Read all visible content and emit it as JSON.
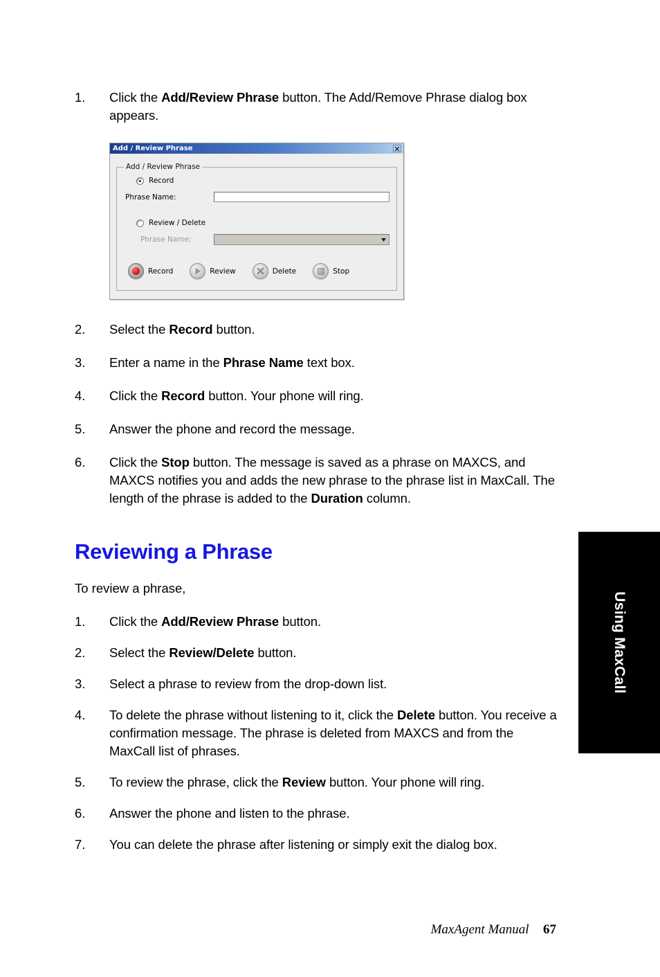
{
  "page": {
    "heading": "Reviewing a Phrase",
    "lead_text": "To review a phrase,",
    "heading_color": "#1616e0"
  },
  "steps_add": [
    {
      "num": "1.",
      "parts": [
        {
          "text": "Click the ",
          "bold": false
        },
        {
          "text": "Add/Review Phrase",
          "bold": true
        },
        {
          "text": " button. The Add/Remove Phrase dialog box appears.",
          "bold": false
        }
      ]
    }
  ],
  "steps_record": [
    {
      "num": "2.",
      "parts": [
        {
          "text": "Select the ",
          "bold": false
        },
        {
          "text": "Record",
          "bold": true
        },
        {
          "text": " button.",
          "bold": false
        }
      ]
    },
    {
      "num": "3.",
      "parts": [
        {
          "text": "Enter a name in the ",
          "bold": false
        },
        {
          "text": "Phrase Name",
          "bold": true
        },
        {
          "text": " text box.",
          "bold": false
        }
      ]
    },
    {
      "num": "4.",
      "parts": [
        {
          "text": "Click the ",
          "bold": false
        },
        {
          "text": "Record",
          "bold": true
        },
        {
          "text": " button. Your phone will ring.",
          "bold": false
        }
      ]
    },
    {
      "num": "5.",
      "parts": [
        {
          "text": "Answer the phone and record the message.",
          "bold": false
        }
      ]
    },
    {
      "num": "6.",
      "parts": [
        {
          "text": "Click the ",
          "bold": false
        },
        {
          "text": "Stop",
          "bold": true
        },
        {
          "text": " button. The message is saved as a phrase on MAXCS, and MAXCS notifies you and adds the new phrase to the phrase list in MaxCall. The length of the phrase is added to the ",
          "bold": false
        },
        {
          "text": "Duration",
          "bold": true
        },
        {
          "text": " column.",
          "bold": false
        }
      ]
    }
  ],
  "steps_review": [
    {
      "num": "1.",
      "parts": [
        {
          "text": "Click the ",
          "bold": false
        },
        {
          "text": "Add/Review Phrase",
          "bold": true
        },
        {
          "text": " button.",
          "bold": false
        }
      ]
    },
    {
      "num": "2.",
      "parts": [
        {
          "text": "Select the ",
          "bold": false
        },
        {
          "text": "Review/Delete",
          "bold": true
        },
        {
          "text": " button.",
          "bold": false
        }
      ]
    },
    {
      "num": "3.",
      "parts": [
        {
          "text": "Select a phrase to review from the drop-down list.",
          "bold": false
        }
      ]
    },
    {
      "num": "4.",
      "parts": [
        {
          "text": "To delete the phrase without listening to it, click the ",
          "bold": false
        },
        {
          "text": "Delete",
          "bold": true
        },
        {
          "text": " button. You receive a confirmation message. The phrase is deleted from MAXCS and from the MaxCall list of phrases.",
          "bold": false
        }
      ]
    },
    {
      "num": "5.",
      "parts": [
        {
          "text": "To review the phrase, click the ",
          "bold": false
        },
        {
          "text": "Review",
          "bold": true
        },
        {
          "text": " button. Your phone will ring.",
          "bold": false
        }
      ]
    },
    {
      "num": "6.",
      "parts": [
        {
          "text": "Answer the phone and listen to the phrase.",
          "bold": false
        }
      ]
    },
    {
      "num": "7.",
      "parts": [
        {
          "text": "You can delete the phrase after listening or simply exit the dialog box.",
          "bold": false
        }
      ]
    }
  ],
  "dialog": {
    "title": "Add / Review Phrase",
    "close_icon": "close-icon",
    "groupbox_legend": "Add / Review Phrase",
    "record_radio_label": "Record",
    "record_radio_checked": true,
    "record_field_label": "Phrase Name:",
    "record_field_value": "",
    "review_radio_label": "Review / Delete",
    "review_radio_checked": false,
    "review_field_label": "Phrase Name:",
    "review_field_value": "",
    "review_field_disabled": true,
    "buttons": [
      {
        "label": "Record",
        "icon": "record-circle-icon",
        "color": "#e01b1b"
      },
      {
        "label": "Review",
        "icon": "play-triangle-icon",
        "color": "#9d9d9d"
      },
      {
        "label": "Delete",
        "icon": "x-mark-icon",
        "color": "#8d8d8d"
      },
      {
        "label": "Stop",
        "icon": "stop-square-icon",
        "color": "#9d9d9d"
      }
    ]
  },
  "side_tab": {
    "label": "Using MaxCall",
    "background": "#000000",
    "text_color": "#ffffff"
  },
  "footer": {
    "manual": "MaxAgent Manual",
    "page_number": "67"
  }
}
